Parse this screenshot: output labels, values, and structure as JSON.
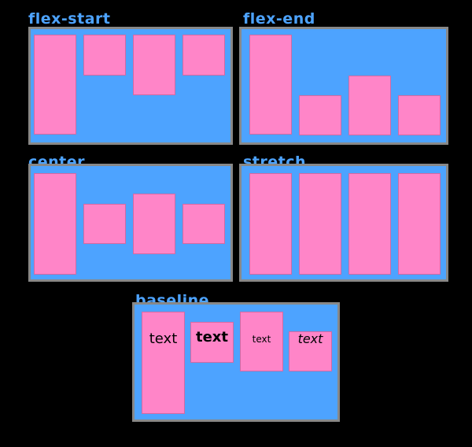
{
  "panels": [
    {
      "id": "flex-start",
      "title": "flex-start"
    },
    {
      "id": "flex-end",
      "title": "flex-end"
    },
    {
      "id": "center",
      "title": "center"
    },
    {
      "id": "stretch",
      "title": "stretch"
    },
    {
      "id": "baseline",
      "title": "baseline"
    }
  ],
  "baseline_items": [
    "text",
    "text",
    "text",
    "text"
  ],
  "colors": {
    "background": "#000000",
    "container": "#4da3ff",
    "container_border": "#888888",
    "item": "#ff85c8",
    "title": "#4da3ff"
  }
}
